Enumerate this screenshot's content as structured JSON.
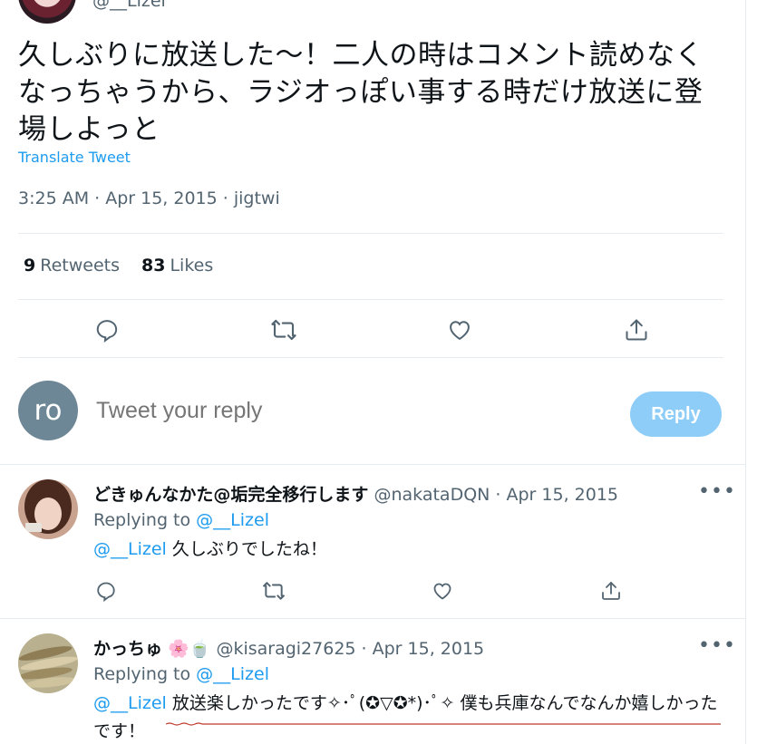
{
  "top": {
    "handle": "@__Lizel"
  },
  "tweet": {
    "text": "久しぶりに放送した〜！二人の時はコメント読めなくなっちゃうから、ラジオっぽい事する時だけ放送に登場しよっと",
    "translate_label": "Translate Tweet",
    "meta": "3:25 AM · Apr 15, 2015 · jigtwi",
    "stats": {
      "retweets_count": "9",
      "retweets_label": "Retweets",
      "likes_count": "83",
      "likes_label": "Likes"
    }
  },
  "compose": {
    "avatar_initials": "ro",
    "placeholder": "Tweet your reply",
    "reply_button": "Reply"
  },
  "replies": [
    {
      "name": "どきゅんなかた@垢完全移行します",
      "handle": "@nakataDQN",
      "date": "· Apr 15, 2015",
      "replying_label": "Replying to",
      "replying_to": "@__Lizel",
      "mention": "@__Lizel",
      "text": " 久しぶりでしたね！"
    },
    {
      "name": "かっちゅ",
      "emoji": "🌸🍵",
      "handle": "@kisaragi27625",
      "date": "· Apr 15, 2015",
      "replying_label": "Replying to",
      "replying_to": "@__Lizel",
      "mention": "@__Lizel",
      "text": " 放送楽しかったです✧･ﾟ(✪▽✪*)･ﾟ✧ 僕も兵庫なんでなんか嬉しかったです！"
    }
  ],
  "more_label": "•••",
  "colors": {
    "accent": "#1d9bf0",
    "muted": "#536471",
    "reply_button_bg": "#8ecdf8"
  }
}
